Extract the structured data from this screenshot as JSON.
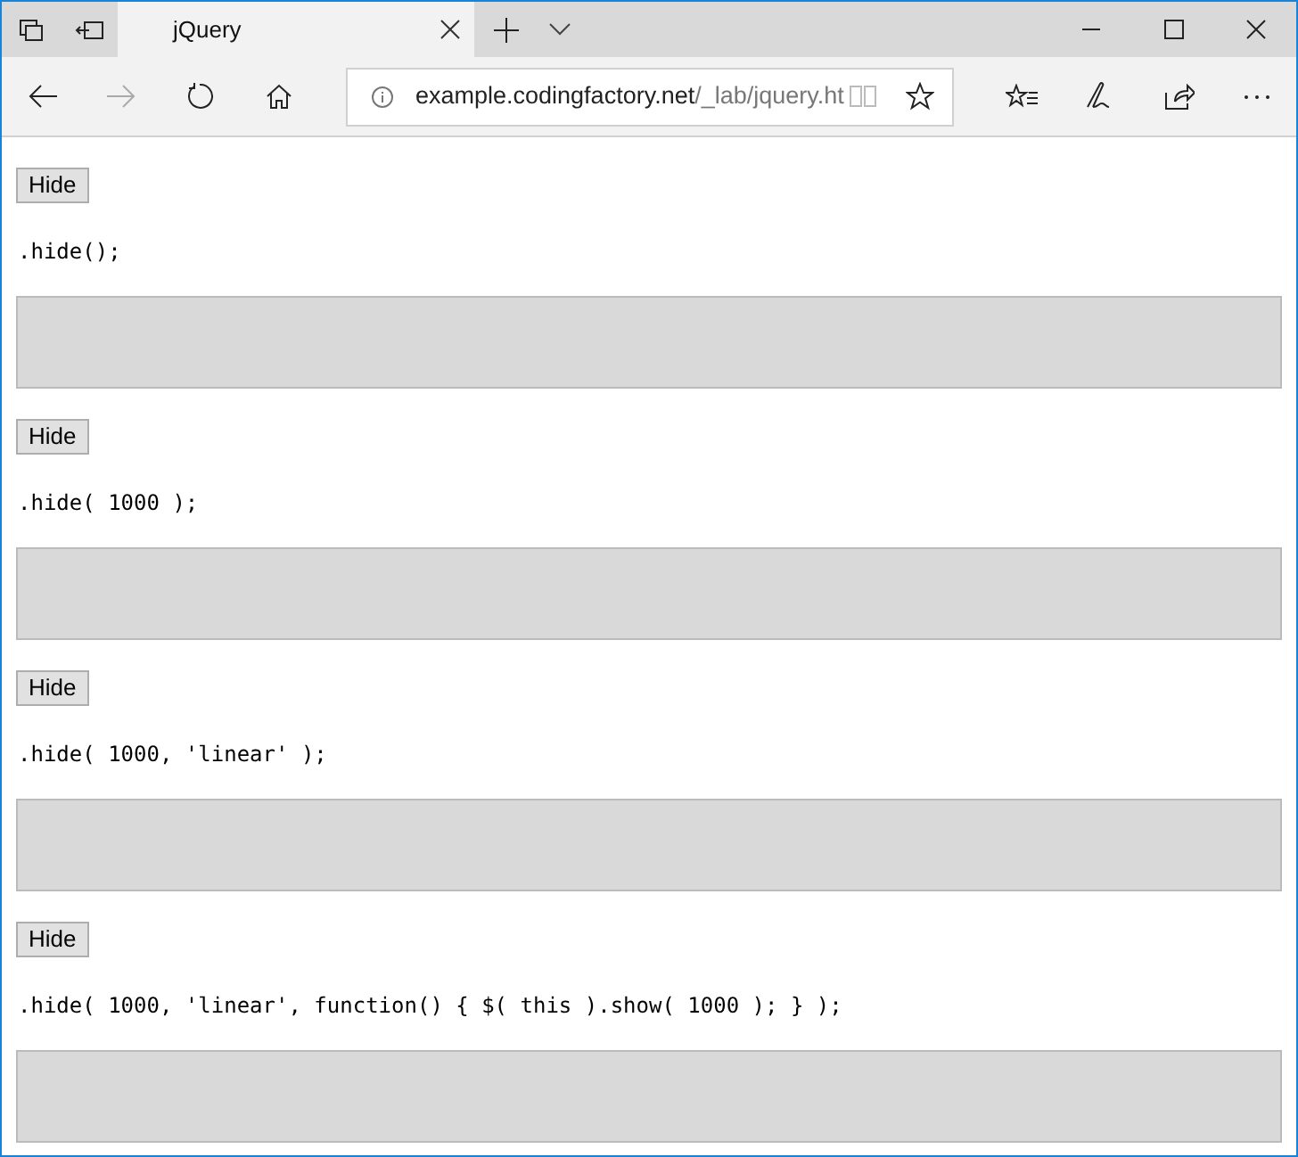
{
  "tab": {
    "title": "jQuery",
    "selected": true
  },
  "address_bar": {
    "host": "example.codingfactory.net",
    "path": "/_lab/jquery.ht"
  },
  "sections": [
    {
      "button": "Hide",
      "code": ".hide();"
    },
    {
      "button": "Hide",
      "code": ".hide( 1000 );"
    },
    {
      "button": "Hide",
      "code": ".hide( 1000, 'linear' );"
    },
    {
      "button": "Hide",
      "code": ".hide( 1000, 'linear', function() { $( this ).show( 1000 ); } );"
    }
  ]
}
